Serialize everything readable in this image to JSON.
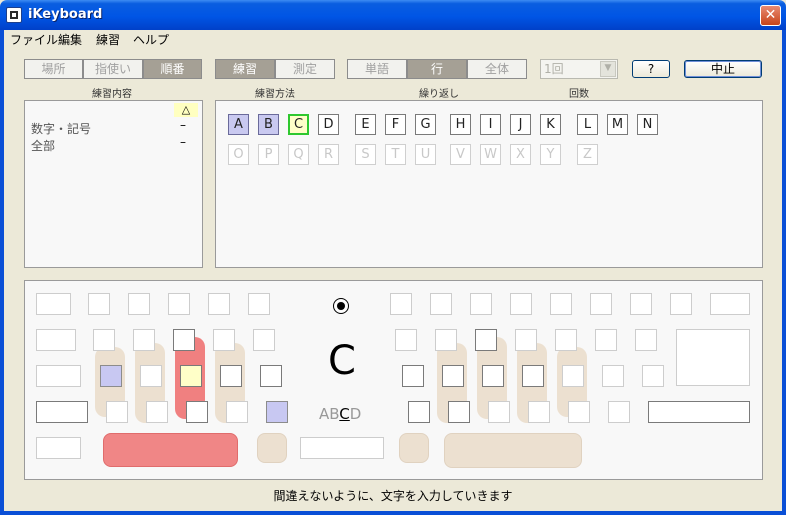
{
  "window": {
    "title": "iKeyboard",
    "close_glyph": "✕"
  },
  "menu": [
    "ファイル",
    "編集",
    "練習",
    "ヘルプ"
  ],
  "toolbar": {
    "content_group": [
      {
        "label": "場所",
        "active": false
      },
      {
        "label": "指使い",
        "active": false
      },
      {
        "label": "順番",
        "active": true
      }
    ],
    "method_group": [
      {
        "label": "練習",
        "active": true
      },
      {
        "label": "測定",
        "active": false
      }
    ],
    "repeat_group": [
      {
        "label": "単語",
        "active": false
      },
      {
        "label": "行",
        "active": true
      },
      {
        "label": "全体",
        "active": false
      }
    ],
    "count_value": "1回",
    "help_label": "?",
    "stop_label": "中止"
  },
  "captions": {
    "content": "練習内容",
    "method": "練習方法",
    "repeat": "繰り返し",
    "count": "回数"
  },
  "content_list": {
    "header_mark": "△",
    "items": [
      {
        "label": "数字・記号",
        "mark": "–"
      },
      {
        "label": "全部",
        "mark": "–"
      }
    ]
  },
  "letters": {
    "row1": [
      {
        "ch": "A",
        "state": "done"
      },
      {
        "ch": "B",
        "state": "done"
      },
      {
        "ch": "C",
        "state": "cur"
      },
      {
        "ch": "D",
        "state": "normal"
      },
      {
        "ch": "E",
        "state": "normal"
      },
      {
        "ch": "F",
        "state": "normal"
      },
      {
        "ch": "G",
        "state": "normal"
      },
      {
        "ch": "H",
        "state": "normal"
      },
      {
        "ch": "I",
        "state": "normal"
      },
      {
        "ch": "J",
        "state": "normal"
      },
      {
        "ch": "K",
        "state": "normal"
      },
      {
        "ch": "L",
        "state": "normal"
      },
      {
        "ch": "M",
        "state": "normal"
      },
      {
        "ch": "N",
        "state": "normal"
      }
    ],
    "row2": [
      {
        "ch": "O"
      },
      {
        "ch": "P"
      },
      {
        "ch": "Q"
      },
      {
        "ch": "R"
      },
      {
        "ch": "S"
      },
      {
        "ch": "T"
      },
      {
        "ch": "U"
      },
      {
        "ch": "V"
      },
      {
        "ch": "W"
      },
      {
        "ch": "X"
      },
      {
        "ch": "Y"
      },
      {
        "ch": "Z"
      }
    ]
  },
  "practice": {
    "current_char": "C",
    "sequence_before": "AB",
    "sequence_current": "C",
    "sequence_after": "D"
  },
  "status": "間違えないように、文字を入力していきます",
  "colors": {
    "title_bar": "#0055e5",
    "done": "#c8c8f2",
    "current": "#ffffc8",
    "active_finger": "#f08080"
  }
}
